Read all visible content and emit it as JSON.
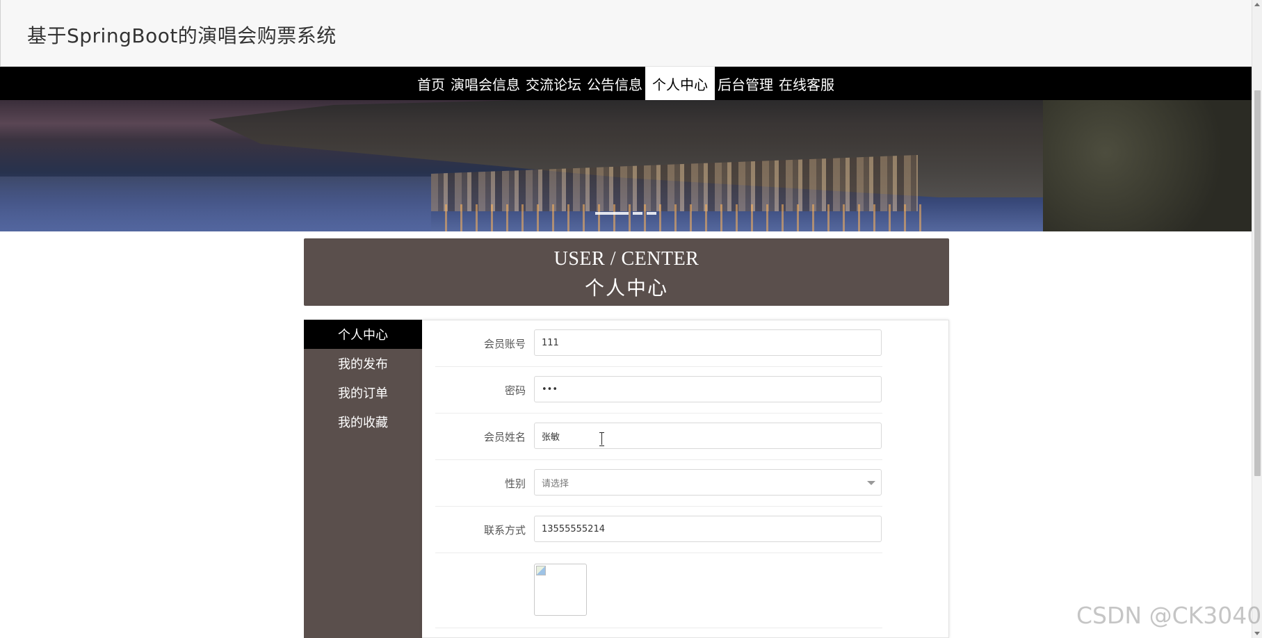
{
  "site": {
    "title": "基于SpringBoot的演唱会购票系统"
  },
  "nav": {
    "items": [
      {
        "label": "首页"
      },
      {
        "label": "演唱会信息"
      },
      {
        "label": "交流论坛"
      },
      {
        "label": "公告信息"
      },
      {
        "label": "个人中心",
        "active": true
      },
      {
        "label": "后台管理"
      },
      {
        "label": "在线客服"
      }
    ]
  },
  "banner": {
    "slides": 3,
    "active_slide": 1
  },
  "heading": {
    "en": "USER / CENTER",
    "zh": "个人中心"
  },
  "sidebar": {
    "items": [
      {
        "label": "个人中心",
        "active": true
      },
      {
        "label": "我的发布"
      },
      {
        "label": "我的订单"
      },
      {
        "label": "我的收藏"
      }
    ]
  },
  "form": {
    "account": {
      "label": "会员账号",
      "value": "111"
    },
    "password": {
      "label": "密码",
      "value": "•••"
    },
    "name": {
      "label": "会员姓名",
      "value": "张敏"
    },
    "gender": {
      "label": "性别",
      "value": "请选择"
    },
    "phone": {
      "label": "联系方式",
      "value": "13555555214"
    }
  },
  "watermark": "CSDN @CK3040",
  "colors": {
    "nav_bg": "#000000",
    "panel_bg": "#5a4f4c",
    "active_bg": "#000000"
  }
}
